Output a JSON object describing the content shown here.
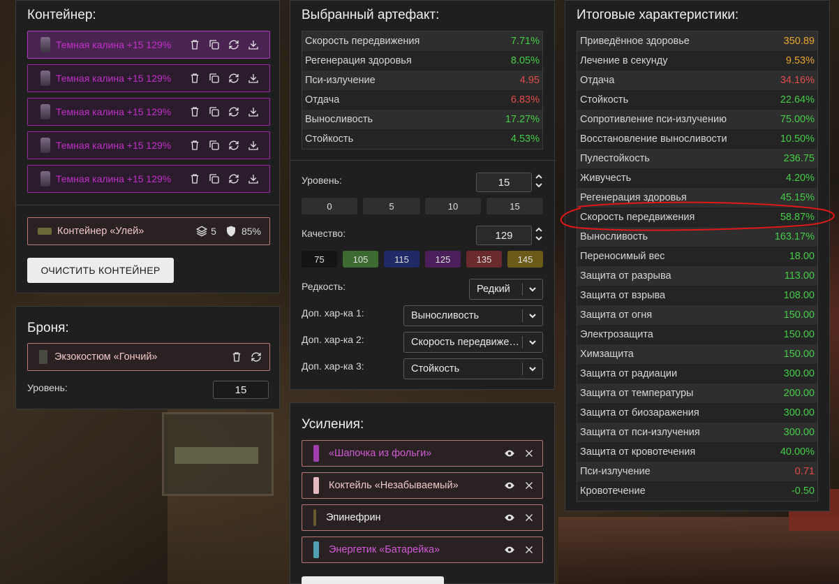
{
  "container": {
    "title": "Контейнер:",
    "slots": [
      {
        "name": "Темная калина +15 129%"
      },
      {
        "name": "Темная калина +15 129%"
      },
      {
        "name": "Темная калина +15 129%"
      },
      {
        "name": "Темная калина +15 129%"
      },
      {
        "name": "Темная калина +15 129%"
      }
    ],
    "box": {
      "name": "Контейнер «Улей»",
      "slots_count": "5",
      "protection": "85%"
    },
    "clear_label": "ОЧИСТИТЬ КОНТЕЙНЕР"
  },
  "armor": {
    "title": "Броня:",
    "item": "Экзокостюм «Гончий»",
    "level_label": "Уровень:",
    "level_value": "15"
  },
  "artifact": {
    "title": "Выбранный артефакт:",
    "stats": [
      {
        "name": "Скорость передвижения",
        "value": "7.71%",
        "color": "green"
      },
      {
        "name": "Регенерация здоровья",
        "value": "8.05%",
        "color": "green"
      },
      {
        "name": "Пси-излучение",
        "value": "4.95",
        "color": "red"
      },
      {
        "name": "Отдача",
        "value": "6.83%",
        "color": "red"
      },
      {
        "name": "Выносливость",
        "value": "17.27%",
        "color": "green"
      },
      {
        "name": "Стойкость",
        "value": "4.53%",
        "color": "green"
      }
    ],
    "level_label": "Уровень:",
    "level_value": "15",
    "level_presets": [
      "0",
      "5",
      "10",
      "15"
    ],
    "quality_label": "Качество:",
    "quality_value": "129",
    "quality_presets": [
      {
        "label": "75",
        "color": "#1a1a1a"
      },
      {
        "label": "105",
        "color": "#3c6b32"
      },
      {
        "label": "115",
        "color": "#1f2a66"
      },
      {
        "label": "125",
        "color": "#4a1f5a"
      },
      {
        "label": "135",
        "color": "#6a2a2e"
      },
      {
        "label": "145",
        "color": "#6b5a1a"
      }
    ],
    "rarity_label": "Редкость:",
    "rarity_value": "Редкий",
    "extra1_label": "Доп. хар-ка 1:",
    "extra1_value": "Выносливость",
    "extra2_label": "Доп. хар-ка 2:",
    "extra2_value": "Скорость передвижения",
    "extra3_label": "Доп. хар-ка 3:",
    "extra3_value": "Стойкость"
  },
  "boosts": {
    "title": "Усиления:",
    "items": [
      {
        "name": "«Шапочка из фольги»",
        "color": "#d259d8",
        "icon_color": "#a23fb0"
      },
      {
        "name": "Коктейль «Незабываемый»",
        "color": "#f0c8c8",
        "icon_color": "#e8b8c0"
      },
      {
        "name": "Эпинефрин",
        "color": "#f0f0f0",
        "icon_color": "#6a5a30"
      },
      {
        "name": "Энергетик «Батарейка»",
        "color": "#d259d8",
        "icon_color": "#4fa0b0"
      }
    ]
  },
  "totals": {
    "title": "Итоговые характеристики:",
    "stats": [
      {
        "name": "Приведённое здоровье",
        "value": "350.89",
        "color": "yellow"
      },
      {
        "name": "Лечение в секунду",
        "value": "9.53%",
        "color": "yellow"
      },
      {
        "name": "Отдача",
        "value": "34.16%",
        "color": "red"
      },
      {
        "name": "Стойкость",
        "value": "22.64%",
        "color": "green"
      },
      {
        "name": "Сопротивление пси-излучению",
        "value": "75.00%",
        "color": "green"
      },
      {
        "name": "Восстановление выносливости",
        "value": "10.50%",
        "color": "green"
      },
      {
        "name": "Пулестойкость",
        "value": "236.75",
        "color": "green"
      },
      {
        "name": "Живучесть",
        "value": "4.20%",
        "color": "green"
      },
      {
        "name": "Регенерация здоровья",
        "value": "45.15%",
        "color": "green"
      },
      {
        "name": "Скорость передвижения",
        "value": "58.87%",
        "color": "green"
      },
      {
        "name": "Выносливость",
        "value": "163.17%",
        "color": "green"
      },
      {
        "name": "Переносимый вес",
        "value": "18.00",
        "color": "green"
      },
      {
        "name": "Защита от разрыва",
        "value": "113.00",
        "color": "green"
      },
      {
        "name": "Защита от взрыва",
        "value": "108.00",
        "color": "green"
      },
      {
        "name": "Защита от огня",
        "value": "150.00",
        "color": "green"
      },
      {
        "name": "Электрозащита",
        "value": "150.00",
        "color": "green"
      },
      {
        "name": "Химзащита",
        "value": "150.00",
        "color": "green"
      },
      {
        "name": "Защита от радиации",
        "value": "300.00",
        "color": "green"
      },
      {
        "name": "Защита от температуры",
        "value": "200.00",
        "color": "green"
      },
      {
        "name": "Защита от биозаражения",
        "value": "300.00",
        "color": "green"
      },
      {
        "name": "Защита от пси-излучения",
        "value": "300.00",
        "color": "green"
      },
      {
        "name": "Защита от кровотечения",
        "value": "40.00%",
        "color": "green"
      },
      {
        "name": "Пси-излучение",
        "value": "0.71",
        "color": "red"
      },
      {
        "name": "Кровотечение",
        "value": "-0.50",
        "color": "green"
      }
    ]
  }
}
